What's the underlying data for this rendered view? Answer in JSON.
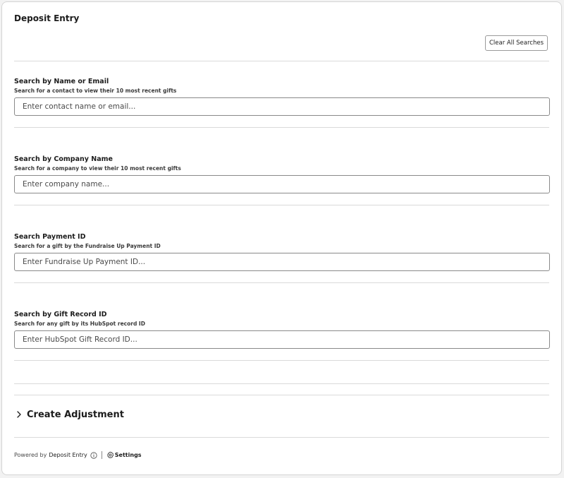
{
  "header": {
    "title": "Deposit Entry",
    "clear_label": "Clear All Searches"
  },
  "sections": [
    {
      "title": "Search by Name or Email",
      "subtitle": "Search for a contact to view their 10 most recent gifts",
      "placeholder": "Enter contact name or email..."
    },
    {
      "title": "Search by Company Name",
      "subtitle": "Search for a company to view their 10 most recent gifts",
      "placeholder": "Enter company name..."
    },
    {
      "title": "Search Payment ID",
      "subtitle": "Search for a gift by the Fundraise Up Payment ID",
      "placeholder": "Enter Fundraise Up Payment ID..."
    },
    {
      "title": "Search by Gift Record ID",
      "subtitle": "Search for any gift by its HubSpot record ID",
      "placeholder": "Enter HubSpot Gift Record ID..."
    }
  ],
  "adjustment": {
    "title": "Create Adjustment"
  },
  "footer": {
    "powered_by": "Powered by",
    "brand": "Deposit Entry",
    "settings_label": "Settings"
  },
  "icons": {
    "chevron": "chevron-right-icon",
    "info": "info-icon",
    "gear": "gear-icon"
  }
}
